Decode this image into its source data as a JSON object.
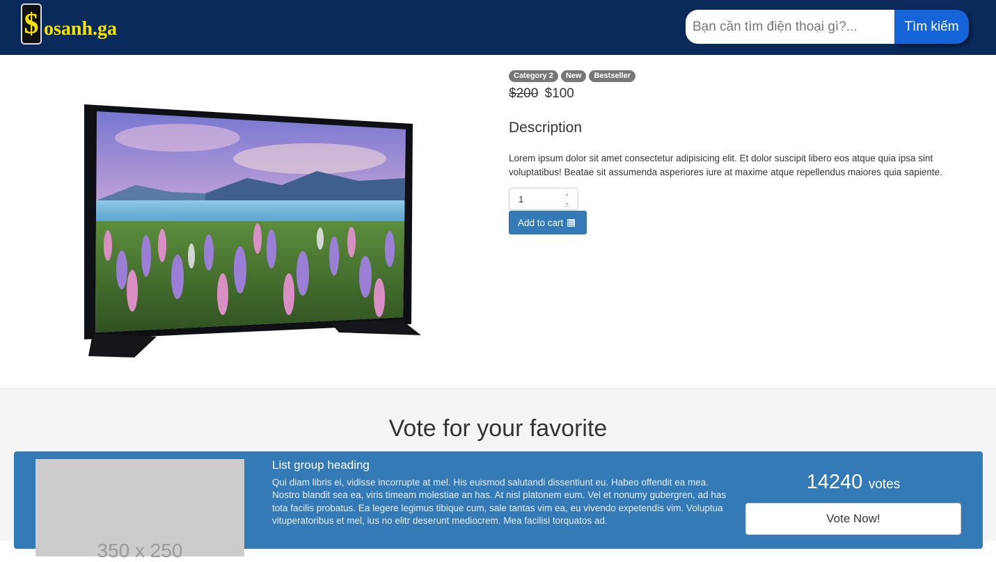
{
  "header": {
    "logo_symbol": "$",
    "logo_text": "osanh.ga",
    "search_placeholder": "Bạn cần tìm điện thoại gì?...",
    "search_button": "Tìm kiếm",
    "background": "#0a2a5c",
    "accent": "#1565d8",
    "logo_color": "#f5e400"
  },
  "product": {
    "badges": [
      "Category 2",
      "New",
      "Bestseller"
    ],
    "old_price": "$200",
    "price": "$100",
    "description_title": "Description",
    "description": "Lorem ipsum dolor sit amet consectetur adipisicing elit. Et dolor suscipit libero eos atque quia ipsa sint voluptatibus! Beatae sit assumenda asperiores iure at maxime atque repellendus maiores quia sapiente.",
    "quantity": "1",
    "add_to_cart": "Add to cart",
    "cart_icon": "cart-icon",
    "button_color": "#337ab7"
  },
  "vote": {
    "title": "Vote for your favorite",
    "placeholder_text": "350 x 250",
    "heading": "List group heading",
    "text": "Qui diam libris ei, vidisse incorrupte at mel. His euismod salutandi dissentiunt eu. Habeo offendit ea mea. Nostro blandit sea ea, viris timeam molestiae an has. At nisl platonem eum. Vel et nonumy gubergren, ad has tota facilis probatus. Ea legere legimus tibique cum, sale tantas vim ea, eu vivendo expetendis vim. Voluptua vituperatoribus et mel, ius no elitr deserunt mediocrem. Mea facilisi torquatos ad.",
    "count": "14240",
    "count_label": "votes",
    "button": "Vote Now!"
  }
}
